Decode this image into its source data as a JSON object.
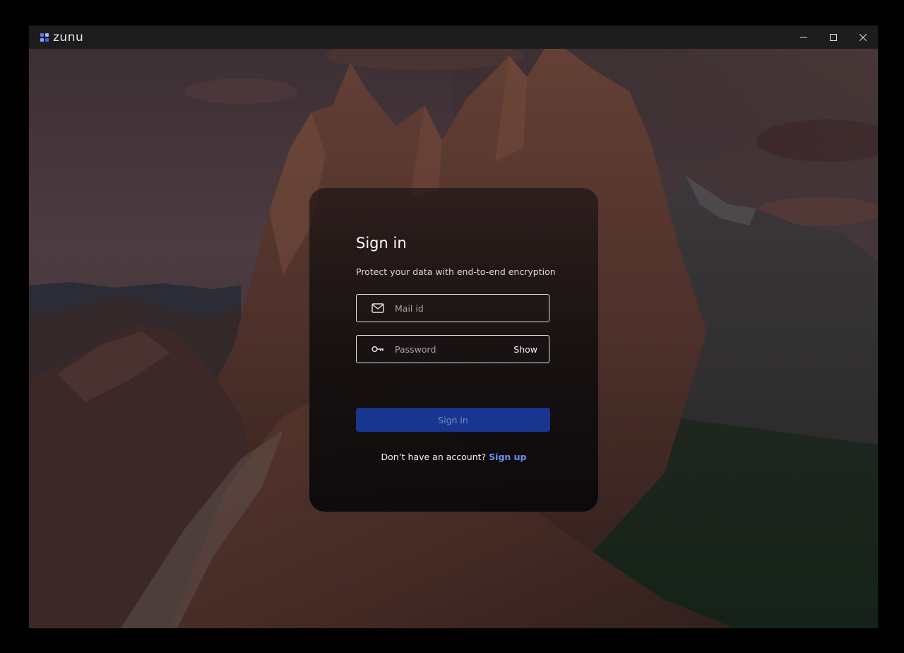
{
  "app": {
    "name": "zunu",
    "logo_icon": "zunu-logo-icon",
    "brand_colors": [
      "#4f7df2",
      "#7fa0f7",
      "#3b62d6",
      "#9db6fa"
    ]
  },
  "window_controls": {
    "minimize_icon": "minimize-icon",
    "maximize_icon": "maximize-icon",
    "close_icon": "close-icon"
  },
  "signin": {
    "title": "Sign in",
    "subtitle": "Protect your data with end-to-end encryption",
    "email": {
      "icon": "mail-icon",
      "placeholder": "Mail id",
      "value": ""
    },
    "password": {
      "icon": "key-icon",
      "placeholder": "Password",
      "value": "",
      "toggle_label": "Show"
    },
    "submit_label": "Sign in",
    "footer_text": "Don’t have an account? ",
    "signup_label": "Sign up"
  },
  "colors": {
    "accent": "#1a3da6",
    "link": "#6f8ff5",
    "titlebar": "#1c1c1c"
  }
}
